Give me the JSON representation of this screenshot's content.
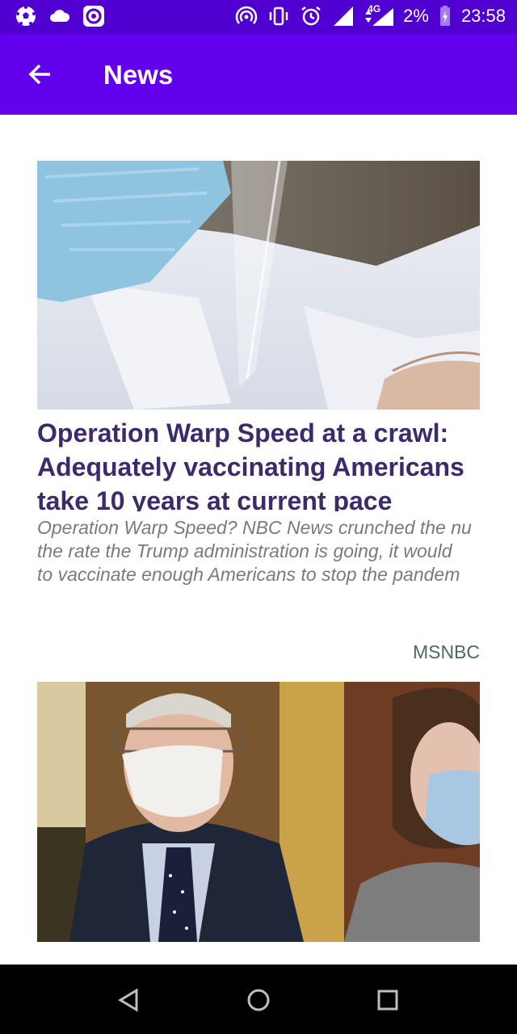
{
  "status_bar": {
    "left_icons": [
      "soccer-ball-icon",
      "cloud-icon",
      "circle-app-icon"
    ],
    "right_icons": [
      "hotspot-icon",
      "vibrate-icon",
      "alarm-icon",
      "signal-icon",
      "signal-4g-icon",
      "battery-charging-icon"
    ],
    "network_label": "4G",
    "battery": "2%",
    "time": "23:58"
  },
  "app_bar": {
    "title": "News",
    "back_icon": "arrow-left-icon"
  },
  "articles": [
    {
      "image_icon": "masked-health-worker-photo",
      "headline_lines": [
        "Operation Warp Speed at a crawl:",
        "Adequately vaccinating Americans",
        "take 10 years at current pace"
      ],
      "summary_lines": [
        "Operation Warp Speed? NBC News crunched the nu",
        "the rate the Trump administration is going, it would",
        "to vaccinate enough Americans to stop the pandem"
      ],
      "source": "MSNBC"
    },
    {
      "image_icon": "masked-politicians-photo"
    }
  ],
  "nav_bar": {
    "back": "triangle-back-icon",
    "home": "circle-home-icon",
    "recents": "square-recents-icon"
  },
  "colors": {
    "status_bar": "#5000d0",
    "app_bar": "#6200ee",
    "headline": "#3d2a6b",
    "summary": "#7a7a7a",
    "source": "#4a6a63"
  }
}
